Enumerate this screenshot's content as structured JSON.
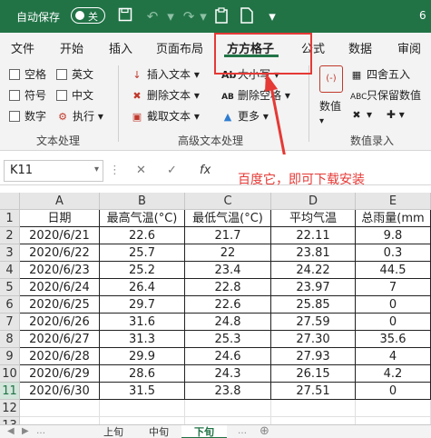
{
  "titlebar": {
    "autosave_label": "自动保存",
    "toggle_state": "关",
    "corner_text": "6"
  },
  "tabs": [
    "文件",
    "开始",
    "插入",
    "页面布局",
    "方方格子",
    "公式",
    "数据",
    "审阅"
  ],
  "ribbon": {
    "text_processing": {
      "checkboxes": [
        "空格",
        "英文",
        "符号",
        "中文",
        "数字"
      ],
      "execute_label": "执行",
      "group_label": "文本处理"
    },
    "advanced_text": {
      "insert_text": "插入文本",
      "delete_text": "删除文本",
      "extract_text": "截取文本",
      "case_label": "大小写",
      "delete_space": "删除空格",
      "more_label": "更多",
      "group_label": "高级文本处理"
    },
    "numeric": {
      "values_label": "数值",
      "round_label": "四舍五入",
      "keep_values_label": "只保留数值",
      "group_label": "数值录入"
    }
  },
  "formula_bar": {
    "name_box": "K11",
    "fx_label": "fx",
    "annotation": "百度它，即可下载安装"
  },
  "grid": {
    "columns": [
      "A",
      "B",
      "C",
      "D",
      "E"
    ],
    "row_numbers": [
      "1",
      "2",
      "3",
      "4",
      "5",
      "6",
      "7",
      "8",
      "9",
      "10",
      "11",
      "12",
      "13"
    ],
    "header": [
      "日期",
      "最高气温(°C)",
      "最低气温(°C)",
      "平均气温",
      "总雨量(mm"
    ],
    "rows": [
      [
        "2020/6/21",
        "22.6",
        "21.7",
        "22.11",
        "9.8"
      ],
      [
        "2020/6/22",
        "25.7",
        "22",
        "23.81",
        "0.3"
      ],
      [
        "2020/6/23",
        "25.2",
        "23.4",
        "24.22",
        "44.5"
      ],
      [
        "2020/6/24",
        "26.4",
        "22.8",
        "23.97",
        "7"
      ],
      [
        "2020/6/25",
        "29.7",
        "22.6",
        "25.85",
        "0"
      ],
      [
        "2020/6/26",
        "31.6",
        "24.8",
        "27.59",
        "0"
      ],
      [
        "2020/6/27",
        "31.3",
        "25.3",
        "27.30",
        "35.6"
      ],
      [
        "2020/6/28",
        "29.9",
        "24.6",
        "27.93",
        "4"
      ],
      [
        "2020/6/29",
        "28.6",
        "24.3",
        "26.15",
        "4.2"
      ],
      [
        "2020/6/30",
        "31.5",
        "23.8",
        "27.51",
        "0"
      ]
    ]
  },
  "sheets": [
    "上旬",
    "中旬",
    "下旬"
  ],
  "colors": {
    "brand": "#217346",
    "highlight": "#e53935"
  }
}
